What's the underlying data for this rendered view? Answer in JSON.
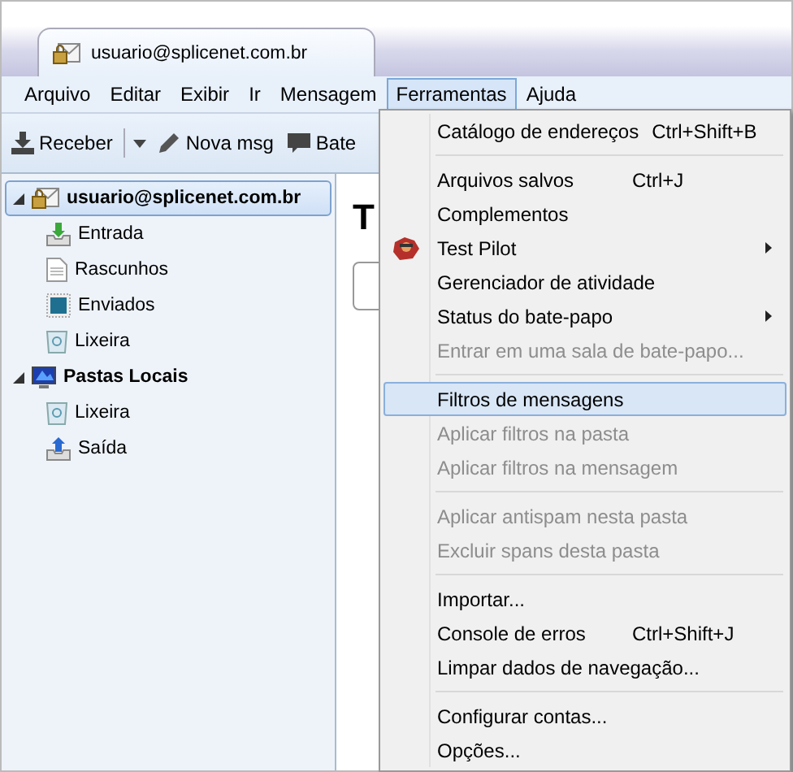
{
  "tab": {
    "title": "usuario@splicenet.com.br"
  },
  "menubar": [
    {
      "label": "Arquivo",
      "selected": false
    },
    {
      "label": "Editar",
      "selected": false
    },
    {
      "label": "Exibir",
      "selected": false
    },
    {
      "label": "Ir",
      "selected": false
    },
    {
      "label": "Mensagem",
      "selected": false
    },
    {
      "label": "Ferramentas",
      "selected": true
    },
    {
      "label": "Ajuda",
      "selected": false
    }
  ],
  "toolbar": [
    {
      "kind": "receive",
      "label": "Receber"
    },
    {
      "kind": "compose",
      "label": "Nova msg"
    },
    {
      "kind": "chat",
      "label": "Bate"
    }
  ],
  "folders": [
    {
      "kind": "account",
      "label": "usuario@splicenet.com.br",
      "selected": true,
      "expanded": true,
      "children": [
        {
          "kind": "inbox",
          "label": "Entrada",
          "selected": false
        },
        {
          "kind": "drafts",
          "label": "Rascunhos",
          "selected": false
        },
        {
          "kind": "sent",
          "label": "Enviados",
          "selected": false
        },
        {
          "kind": "trash",
          "label": "Lixeira",
          "selected": false
        }
      ]
    },
    {
      "kind": "local",
      "label": "Pastas Locais",
      "selected": false,
      "expanded": true,
      "children": [
        {
          "kind": "trash",
          "label": "Lixeira",
          "selected": false
        },
        {
          "kind": "outbox",
          "label": "Saída",
          "selected": false
        }
      ]
    }
  ],
  "content": {
    "heading": "T"
  },
  "menu": [
    {
      "kind": "item",
      "label": "Catálogo de endereços",
      "shortcut": "Ctrl+Shift+B",
      "disabled": false,
      "selected": false,
      "submenu": false,
      "icon": false
    },
    {
      "kind": "separator"
    },
    {
      "kind": "item",
      "label": "Arquivos salvos",
      "shortcut": "Ctrl+J",
      "disabled": false,
      "selected": false,
      "submenu": false,
      "icon": false
    },
    {
      "kind": "item",
      "label": "Complementos",
      "disabled": false,
      "selected": false,
      "submenu": false,
      "icon": false
    },
    {
      "kind": "item",
      "label": "Test Pilot",
      "disabled": false,
      "selected": false,
      "submenu": true,
      "icon": true
    },
    {
      "kind": "item",
      "label": "Gerenciador de atividade",
      "disabled": false,
      "selected": false,
      "submenu": false,
      "icon": false
    },
    {
      "kind": "item",
      "label": "Status do bate-papo",
      "disabled": false,
      "selected": false,
      "submenu": true,
      "icon": false
    },
    {
      "kind": "item",
      "label": "Entrar em uma sala de bate-papo...",
      "disabled": true,
      "selected": false,
      "submenu": false,
      "icon": false
    },
    {
      "kind": "separator"
    },
    {
      "kind": "item",
      "label": "Filtros de mensagens",
      "disabled": false,
      "selected": true,
      "submenu": false,
      "icon": false
    },
    {
      "kind": "item",
      "label": "Aplicar filtros na pasta",
      "disabled": true,
      "selected": false,
      "submenu": false,
      "icon": false
    },
    {
      "kind": "item",
      "label": "Aplicar filtros na mensagem",
      "disabled": true,
      "selected": false,
      "submenu": false,
      "icon": false
    },
    {
      "kind": "separator"
    },
    {
      "kind": "item",
      "label": "Aplicar antispam nesta pasta",
      "disabled": true,
      "selected": false,
      "submenu": false,
      "icon": false
    },
    {
      "kind": "item",
      "label": "Excluir spans desta pasta",
      "disabled": true,
      "selected": false,
      "submenu": false,
      "icon": false
    },
    {
      "kind": "separator"
    },
    {
      "kind": "item",
      "label": "Importar...",
      "disabled": false,
      "selected": false,
      "submenu": false,
      "icon": false
    },
    {
      "kind": "item",
      "label": "Console de erros",
      "shortcut": "Ctrl+Shift+J",
      "disabled": false,
      "selected": false,
      "submenu": false,
      "icon": false
    },
    {
      "kind": "item",
      "label": "Limpar dados de navegação...",
      "disabled": false,
      "selected": false,
      "submenu": false,
      "icon": false
    },
    {
      "kind": "separator"
    },
    {
      "kind": "item",
      "label": "Configurar contas...",
      "disabled": false,
      "selected": false,
      "submenu": false,
      "icon": false
    },
    {
      "kind": "item",
      "label": "Opções...",
      "disabled": false,
      "selected": false,
      "submenu": false,
      "icon": false
    }
  ]
}
